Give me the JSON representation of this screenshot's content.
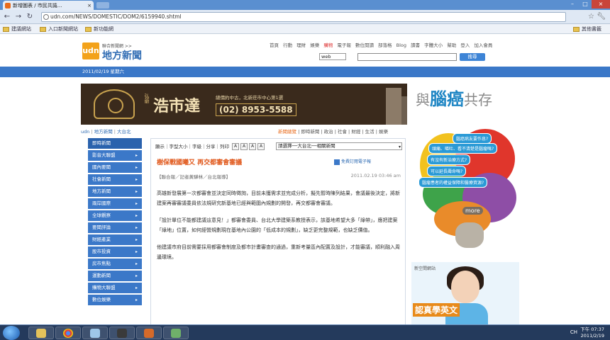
{
  "browser": {
    "tab_title": "新增圖表 / 市民共識...",
    "tab_close": "×",
    "url": "udn.com/NEWS/DOMESTIC/DOM2/6159940.shtml",
    "bookmarks": [
      "建議網站",
      "入口新聞網站",
      "新功能網"
    ],
    "other_bookmarks": "其他書籤"
  },
  "site": {
    "logo_small": "聯合新聞網 >>",
    "logo_big": "地方新聞",
    "logo_mark": "udn",
    "topnav": [
      "首頁",
      "行動",
      "理財",
      "娛樂",
      "購物",
      "電子報",
      "數位閱讀",
      "部落格",
      "Blog",
      "讀書",
      "字體大小",
      "幫助",
      "登入",
      "加入會員"
    ],
    "search_type": "web",
    "search_button": "搜尋",
    "date_bar": "2011/02/19 星期六"
  },
  "banner": {
    "brand_sub": "弘爺",
    "brand_name": "浩市達",
    "info": "總價約中古，北新莊市中心第1選",
    "phone": "(02) 8953-5588"
  },
  "breadcrumb": [
    "udn",
    "地方新聞",
    "大台北"
  ],
  "category_links": [
    "新聞總覽",
    "即時新聞",
    "政治",
    "社會",
    "財經",
    "生活",
    "娛樂"
  ],
  "leftnav": [
    "即時新聞",
    "影音大聯盟",
    "國內要聞",
    "社會新聞",
    "地方新聞",
    "兩岸國際",
    "全球觀察",
    "要聞評論",
    "財經產業",
    "股市投資",
    "房市焦點",
    "運動新聞",
    "購物大聯盟",
    "數位娛樂"
  ],
  "article": {
    "toolbar_label": "顯示｜字型大小｜字級｜分享｜列印",
    "font_buttons": [
      "A",
      "A",
      "A",
      "A"
    ],
    "region_select": "請選擇──大台北──相關新聞",
    "title": "樹保戰國曦又 再交都審會審議",
    "share": "免費訂閱電子報",
    "meta": "【聯合報／記者黃驊林／台北報導】",
    "date": "2011.02.19 03:46 am",
    "paragraphs": [
      "高雄新發展第一次都審會並決定同時徵詢，目前未獲需求並完成分析，擬先暫時陳列結果，會議最後決定，將新建案再審審議委員依法規研究新基地已經與範圍內規劃的開發，再交都審會審議。",
      "「設計單位不能都建議這意見！」都審會委員、台北大學建築系教授表示，該基地希望大多「綠帶」，應把建案「綠地」位置，如何經營規劃現在基地內公園的「低成本的規劃」，缺乏更完整規範，也缺乏價值。",
      "他建議市府目前需要採用都審會制度及都市計畫審查的通過，重新考量區內配置及設計，才能審議，順利融入周邊環境。"
    ]
  },
  "ad": {
    "head_pre": "與",
    "head_bold": "腦癌",
    "head_post": "共存",
    "bubbles": [
      "腦癌病友要作息?",
      "頭痛、嘔吐、看不清楚是腦瘤嗎?",
      "有沒有新治療方式?",
      "可以延長壽命嗎?",
      "腦瘤患者的權益保障和醫療資源?"
    ],
    "more": "more",
    "girl_label": "新空間網站",
    "girl_cta": "認真學英文"
  },
  "taskbar": {
    "tray": "CH",
    "time": "下午 07:37",
    "date": "2011/2/19"
  }
}
